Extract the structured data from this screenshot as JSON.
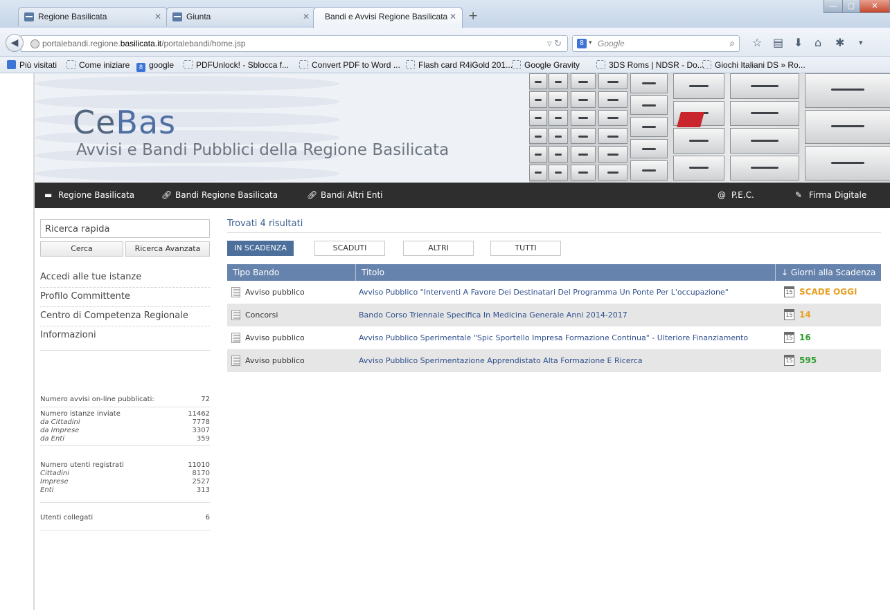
{
  "browser": {
    "tabs": [
      {
        "title": "Regione Basilicata",
        "active": false
      },
      {
        "title": "Giunta",
        "active": false
      },
      {
        "title": "Bandi e Avvisi Regione Basilicata",
        "active": true
      }
    ],
    "url": {
      "prefix": "portalebandi.regione.",
      "host": "basilicata.it",
      "path": "/portalebandi/home.jsp"
    },
    "search": {
      "placeholder": "Google",
      "engine_icon": "8"
    },
    "bookmarks": [
      {
        "label": "Più visitati",
        "icon": "sq"
      },
      {
        "label": "Come iniziare",
        "icon": "dash"
      },
      {
        "label": "google",
        "icon": "g8"
      },
      {
        "label": "PDFUnlock! - Sblocca f...",
        "icon": "dash"
      },
      {
        "label": "Convert PDF to Word ...",
        "icon": "dash"
      },
      {
        "label": "Flash card R4iGold 201...",
        "icon": "dash"
      },
      {
        "label": "Google Gravity",
        "icon": "dash"
      },
      {
        "label": "3DS Roms | NDSR - Do...",
        "icon": "dash"
      },
      {
        "label": "Giochi Italiani DS » Ro...",
        "icon": "dash"
      }
    ]
  },
  "header": {
    "logo_plain": "Ce",
    "logo_accent": "Bas",
    "subtitle": "Avvisi e Bandi Pubblici della Regione Basilicata"
  },
  "nav": {
    "left": [
      "Regione Basilicata",
      "Bandi Regione Basilicata",
      "Bandi Altri Enti"
    ],
    "right": [
      "P.E.C.",
      "Firma Digitale"
    ]
  },
  "sidebar": {
    "quick_search_value": "Ricerca rapida",
    "search_button": "Cerca",
    "advanced_button": "Ricerca Avanzata",
    "menu": [
      "Accedi alle tue istanze",
      "Profilo Committente",
      "Centro di Competenza Regionale",
      "Informazioni"
    ],
    "stats": {
      "published_label": "Numero avvisi on-line pubblicati:",
      "published_value": "72",
      "instances_label": "Numero istanze inviate",
      "instances_value": "11462",
      "instances_breakdown": [
        {
          "label": "da Cittadini",
          "value": "7778"
        },
        {
          "label": "da Imprese",
          "value": "3307"
        },
        {
          "label": "da Enti",
          "value": "359"
        }
      ],
      "users_label": "Numero utenti registrati",
      "users_value": "11010",
      "users_breakdown": [
        {
          "label": "Cittadini",
          "value": "8170"
        },
        {
          "label": "Imprese",
          "value": "2527"
        },
        {
          "label": "Enti",
          "value": "313"
        }
      ],
      "online_label": "Utenti collegati",
      "online_value": "6"
    }
  },
  "results": {
    "summary": "Trovati 4 risultati",
    "filters": [
      "IN SCADENZA",
      "SCADUTI",
      "ALTRI",
      "TUTTI"
    ],
    "selected_filter": "IN SCADENZA",
    "columns": [
      "Tipo Bando",
      "Titolo",
      "↓ Giorni alla Scadenza"
    ],
    "rows": [
      {
        "tipo": "Avviso pubblico",
        "titolo": "Avviso Pubblico \"Interventi A Favore Dei Destinatari Del Programma Un Ponte Per L'occupazione\"",
        "giorni": "SCADE OGGI",
        "color": "#e8a023"
      },
      {
        "tipo": "Concorsi",
        "titolo": "Bando Corso Triennale Specifica In Medicina Generale Anni 2014-2017",
        "giorni": "14",
        "color": "#e8a023"
      },
      {
        "tipo": "Avviso pubblico",
        "titolo": "Avviso Pubblico Sperimentale \"Spic Sportello Impresa Formazione Continua\" - Ulteriore Finanziamento",
        "giorni": "16",
        "color": "#2e9a2e"
      },
      {
        "tipo": "Avviso pubblico",
        "titolo": "Avviso Pubblico Sperimentazione Apprendistato Alta Formazione E Ricerca",
        "giorni": "595",
        "color": "#2e9a2e"
      }
    ]
  }
}
